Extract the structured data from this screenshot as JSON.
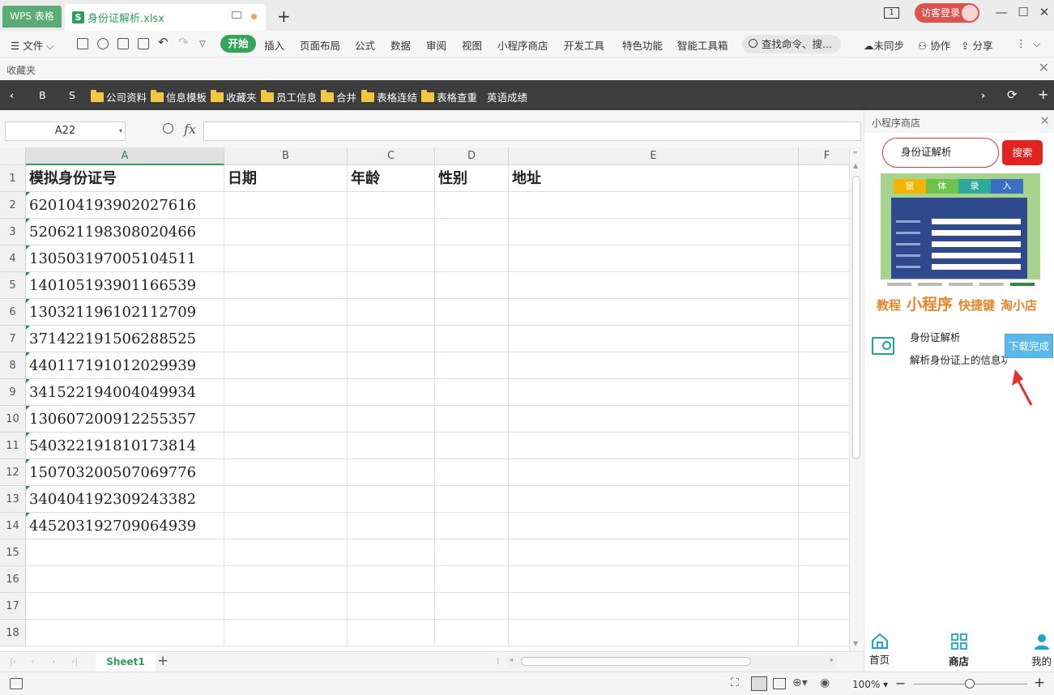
{
  "titlebar": {
    "app_tab": "WPS 表格",
    "doc_tab": "身份证解析.xlsx",
    "doc_icon": "S",
    "window_count": "1",
    "login": "访客登录"
  },
  "menu": {
    "file": "文件",
    "tabs": [
      "开始",
      "插入",
      "页面布局",
      "公式",
      "数据",
      "审阅",
      "视图",
      "小程序商店",
      "开发工具",
      "特色功能",
      "智能工具箱"
    ],
    "search": "查找命令、搜...",
    "sync": "未同步",
    "collab": "协作",
    "share": "分享"
  },
  "favorites": {
    "title": "收藏夹",
    "items": [
      "B",
      "S",
      "公司资料",
      "信息模板",
      "收藏夹",
      "员工信息",
      "合并",
      "表格连结",
      "表格查重",
      "英语成绩"
    ]
  },
  "formula": {
    "cell_ref": "A22",
    "fx": "fx",
    "value": ""
  },
  "grid": {
    "columns": [
      "A",
      "B",
      "C",
      "D",
      "E",
      "F"
    ],
    "header_row": [
      "模拟身份证号",
      "日期",
      "年龄",
      "性别",
      "地址"
    ],
    "ids": [
      "620104193902027616",
      "520621198308020466",
      "130503197005104511",
      "140105193901166539",
      "130321196102112709",
      "371422191506288525",
      "440117191012029939",
      "341522194004049934",
      "130607200912255357",
      "540322191810173814",
      "150703200507069776",
      "340404192309243382",
      "445203192709064939"
    ],
    "row_numbers": [
      "1",
      "2",
      "3",
      "4",
      "5",
      "6",
      "7",
      "8",
      "9",
      "10",
      "11",
      "12",
      "13",
      "14",
      "15",
      "16",
      "17",
      "18"
    ]
  },
  "sheets": {
    "active": "Sheet1",
    "add": "+"
  },
  "status": {
    "zoom": "100%"
  },
  "panel": {
    "title": "小程序商店",
    "search_value": "身份证解析",
    "search_button": "搜索",
    "promo_steps": [
      "窗",
      "体",
      "录",
      "入"
    ],
    "promo_links": [
      "教程",
      "小程序",
      "快捷键",
      "淘小店"
    ],
    "app_name": "身份证解析",
    "app_desc": "解析身份证上的信息功能",
    "download_button": "下载完成",
    "nav": [
      "首页",
      "商店",
      "我的"
    ]
  },
  "colors": {
    "accent_green": "#35a35a",
    "panel_red": "#e32222",
    "download_blue": "#5bb8e8",
    "promo_orange": "#e8852c"
  }
}
